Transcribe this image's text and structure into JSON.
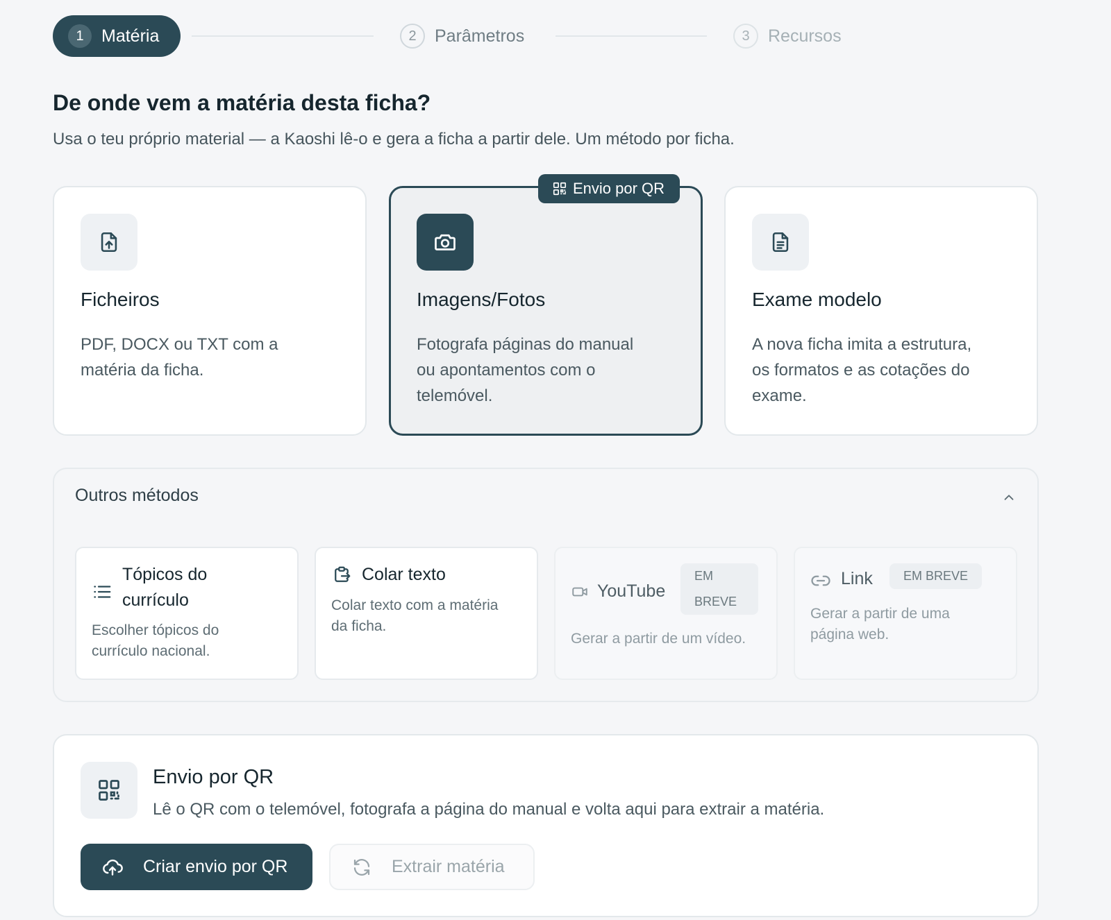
{
  "stepper": {
    "steps": [
      {
        "number": "1",
        "label": "Matéria",
        "state": "active"
      },
      {
        "number": "2",
        "label": "Parâmetros",
        "state": "upcoming"
      },
      {
        "number": "3",
        "label": "Recursos",
        "state": "upcoming"
      }
    ]
  },
  "header": {
    "title": "De onde vem a matéria desta ficha?",
    "subtitle": "Usa o teu próprio material — a Kaoshi lê-o e gera a ficha a partir dele. Um método por ficha."
  },
  "methods": [
    {
      "icon": "file-upload-icon",
      "title": "Ficheiros",
      "desc_lines": [
        "PDF, DOCX ou TXT com a",
        "matéria da ficha."
      ],
      "selected": false
    },
    {
      "icon": "camera-icon",
      "title": "Imagens/Fotos",
      "desc_lines": [
        "Fotografa páginas do manual",
        "ou apontamentos com o",
        "telemóvel."
      ],
      "selected": true,
      "badge": "Envio por QR"
    },
    {
      "icon": "document-icon",
      "title": "Exame modelo",
      "desc_lines": [
        "A nova ficha imita a estrutura,",
        "os formatos e as cotações do",
        "exame."
      ],
      "selected": false
    }
  ],
  "other_methods": {
    "title": "Outros métodos",
    "expanded": true,
    "items": [
      {
        "icon": "list-icon",
        "title_lines": [
          "Tópicos do",
          "currículo"
        ],
        "desc_lines": [
          "Escolher tópicos do",
          "currículo nacional."
        ],
        "enabled": true
      },
      {
        "icon": "paste-icon",
        "title_lines": [
          "Colar texto"
        ],
        "desc_lines": [
          "Colar texto com a matéria",
          "da ficha."
        ],
        "enabled": true
      },
      {
        "icon": "video-icon",
        "title_lines": [
          "YouTube"
        ],
        "desc_lines": [
          "Gerar a partir de um vídeo."
        ],
        "enabled": false,
        "badge_lines": [
          "EM",
          "BREVE"
        ]
      },
      {
        "icon": "link-icon",
        "title_lines": [
          "Link"
        ],
        "desc_lines": [
          "Gerar a partir de uma",
          "página web."
        ],
        "enabled": false,
        "badge": "EM BREVE"
      }
    ]
  },
  "qr_panel": {
    "title": "Envio por QR",
    "description": "Lê o QR com o telemóvel, fotografa a página do manual e volta aqui para extrair a matéria.",
    "primary_button": "Criar envio por QR",
    "secondary_button": "Extrair matéria",
    "secondary_enabled": false
  },
  "colors": {
    "accent": "#2b4a56",
    "background": "#f5f6f8",
    "card_border": "#e3e8eb"
  }
}
